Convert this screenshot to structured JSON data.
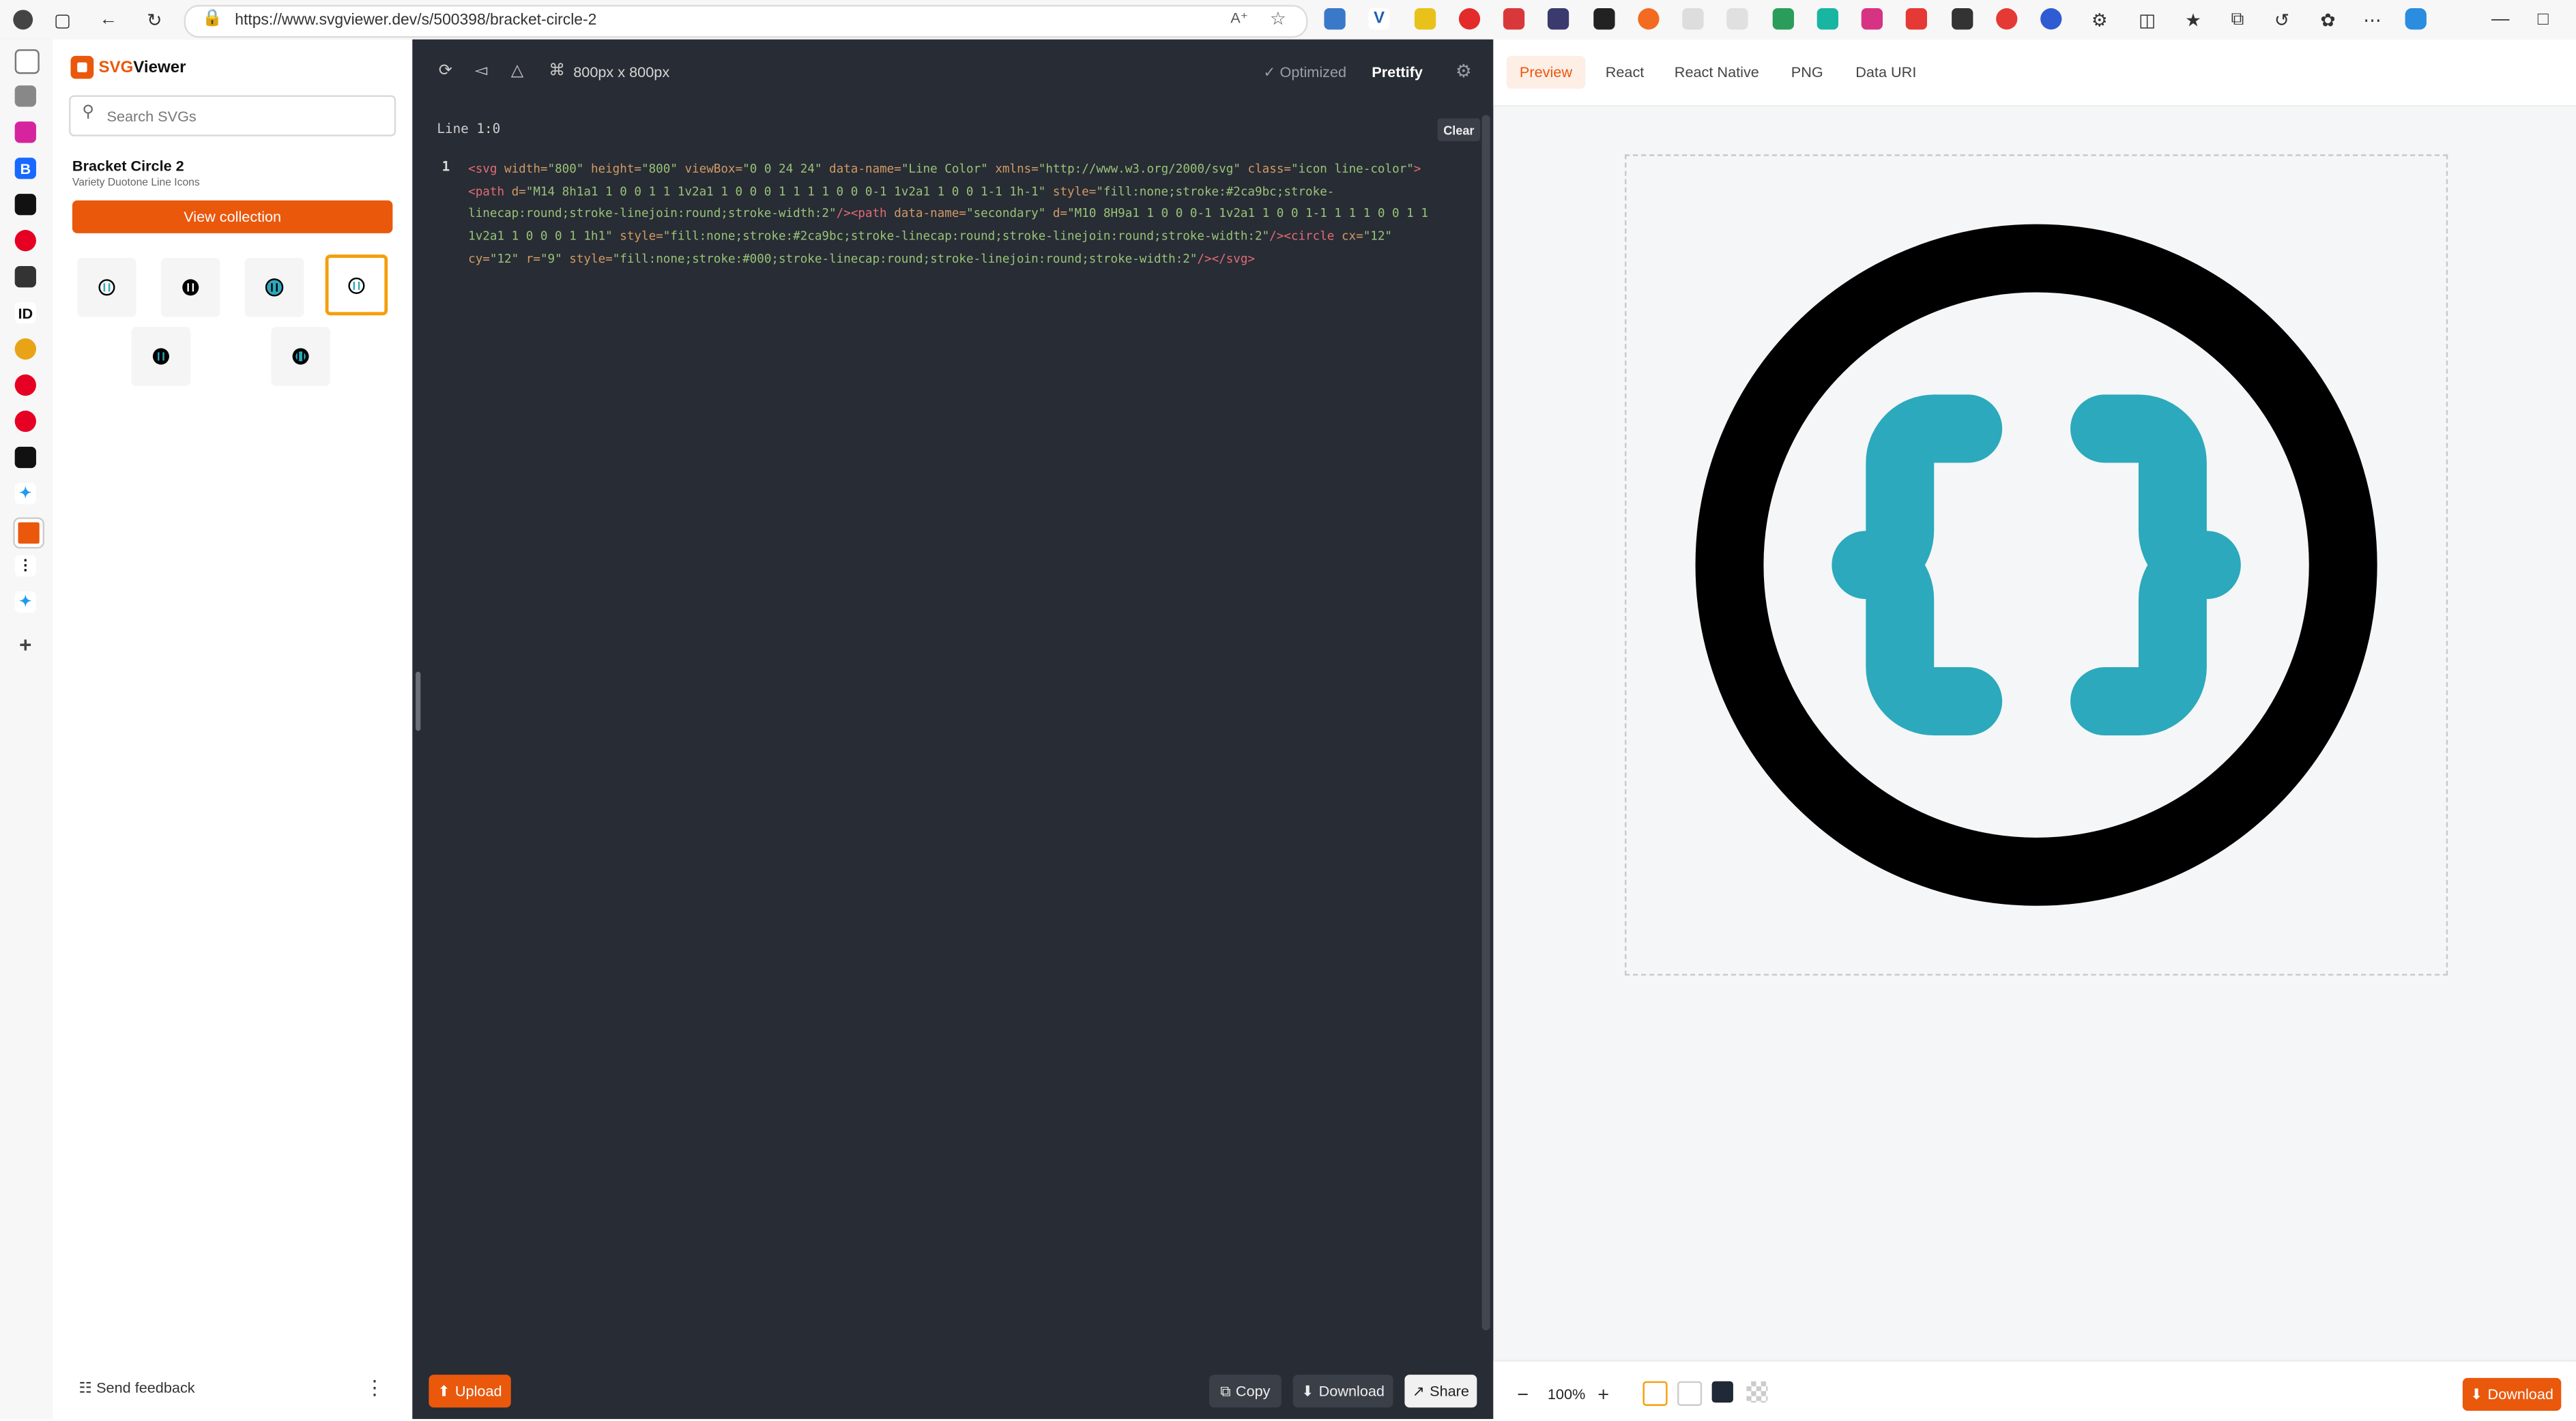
{
  "browser": {
    "url": "https://www.svgviewer.dev/s/500398/bracket-circle-2"
  },
  "app": {
    "brand_prefix": "SVG",
    "brand_suffix": "Viewer",
    "search_placeholder": "Search SVGs",
    "icon_title": "Bracket Circle 2",
    "icon_subtitle": "Variety Duotone Line Icons",
    "view_collection": "View collection",
    "send_feedback": "Send feedback"
  },
  "editor": {
    "dimensions": "800px x 800px",
    "optimized": "Optimized",
    "prettify": "Prettify",
    "line_pos": "Line 1:0",
    "clear": "Clear",
    "line_number": "1",
    "upload": "Upload",
    "copy": "Copy",
    "download": "Download",
    "share": "Share"
  },
  "code_segments": [
    {
      "c": "t",
      "s": "<svg "
    },
    {
      "c": "a",
      "s": "width="
    },
    {
      "c": "v",
      "s": "\"800\" "
    },
    {
      "c": "a",
      "s": "height="
    },
    {
      "c": "v",
      "s": "\"800\" "
    },
    {
      "c": "a",
      "s": "viewBox="
    },
    {
      "c": "v",
      "s": "\"0 0 24 24\" "
    },
    {
      "c": "a",
      "s": "data-name="
    },
    {
      "c": "v",
      "s": "\"Line Color\" "
    },
    {
      "c": "a",
      "s": "xmlns="
    },
    {
      "c": "v",
      "s": "\"http://www.w3.org/2000/svg\" "
    },
    {
      "c": "a",
      "s": "class="
    },
    {
      "c": "v",
      "s": "\"icon line-color\""
    },
    {
      "c": "t",
      "s": ">\n<path "
    },
    {
      "c": "a",
      "s": "d="
    },
    {
      "c": "v",
      "s": "\"M14 8h1a1 1 0 0 1 1 1v2a1 1 0 0 0 1 1 1 1 0 0 0-1 1v2a1 1 0 0 1-1 1h-1\" "
    },
    {
      "c": "a",
      "s": "style="
    },
    {
      "c": "v",
      "s": "\"fill:none;stroke:#2ca9bc;stroke-\nlinecap:round;stroke-linejoin:round;stroke-width:2\""
    },
    {
      "c": "t",
      "s": "/><path "
    },
    {
      "c": "a",
      "s": "data-name="
    },
    {
      "c": "v",
      "s": "\"secondary\" "
    },
    {
      "c": "a",
      "s": "d="
    },
    {
      "c": "v",
      "s": "\"M10 8H9a1 1 0 0 0-1 1v2a1 1 0 0 1-1 1 1 1 0 0 1 1\n1v2a1 1 0 0 0 1 1h1\" "
    },
    {
      "c": "a",
      "s": "style="
    },
    {
      "c": "v",
      "s": "\"fill:none;stroke:#2ca9bc;stroke-linecap:round;stroke-linejoin:round;stroke-width:2\""
    },
    {
      "c": "t",
      "s": "/><circle "
    },
    {
      "c": "a",
      "s": "cx="
    },
    {
      "c": "v",
      "s": "\"12\"\n"
    },
    {
      "c": "a",
      "s": "cy="
    },
    {
      "c": "v",
      "s": "\"12\" "
    },
    {
      "c": "a",
      "s": "r="
    },
    {
      "c": "v",
      "s": "\"9\" "
    },
    {
      "c": "a",
      "s": "style="
    },
    {
      "c": "v",
      "s": "\"fill:none;stroke:#000;stroke-linecap:round;stroke-linejoin:round;stroke-width:2\""
    },
    {
      "c": "t",
      "s": "/></svg>"
    }
  ],
  "preview": {
    "tabs": [
      "Preview",
      "React",
      "React Native",
      "PNG",
      "Data URI"
    ],
    "zoom": "100%",
    "download": "Download",
    "icon_stroke": "#2ca9bc",
    "circle_stroke": "#000"
  },
  "colors": {
    "accent": "#ea580c",
    "editor_bg": "#282c34"
  }
}
